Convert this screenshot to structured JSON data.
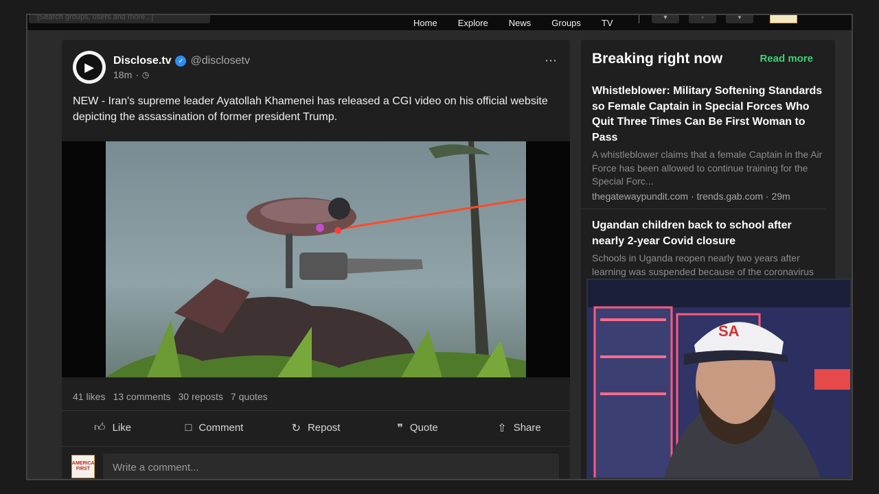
{
  "topbar": {
    "search_text": "[Search groups, users and more...]",
    "nav": [
      "Home",
      "Explore",
      "News",
      "Groups",
      "TV"
    ]
  },
  "post": {
    "author_name": "Disclose.tv",
    "author_handle": "@disclosetv",
    "time": "18m",
    "more": "⋯",
    "text": "NEW - Iran's supreme leader Ayatollah Khamenei has released a CGI video on his official website depicting the assassination of former president Trump.",
    "stats": {
      "likes": "41 likes",
      "comments": "13 comments",
      "reposts": "30 reposts",
      "quotes": "7 quotes"
    },
    "actions": {
      "like": "Like",
      "comment": "Comment",
      "repost": "Repost",
      "quote": "Quote",
      "share": "Share"
    },
    "comment_placeholder": "Write a comment...",
    "commenter_avatar_text": "AMERICA FIRST"
  },
  "sidebar": {
    "title": "Breaking right now",
    "read_more": "Read more",
    "articles": [
      {
        "headline": "Whistleblower: Military Softening Standards so Female Captain in Special Forces Who Quit Three Times Can Be First Woman to Pass",
        "summary": "A whistleblower claims that a female Captain in the Air Force has been allowed to continue training for the Special Forc...",
        "source": "thegatewaypundit.com · trends.gab.com · 29m"
      },
      {
        "headline": "Ugandan children back to school after nearly 2-year Covid closure",
        "summary": "Schools in Uganda reopen nearly two years after learning was suspended because of the coronavirus",
        "source": ""
      }
    ]
  },
  "colors": {
    "accent_green": "#3fcf7a",
    "verified_blue": "#2d8ef0",
    "panel_bg": "#1f1f1f"
  }
}
